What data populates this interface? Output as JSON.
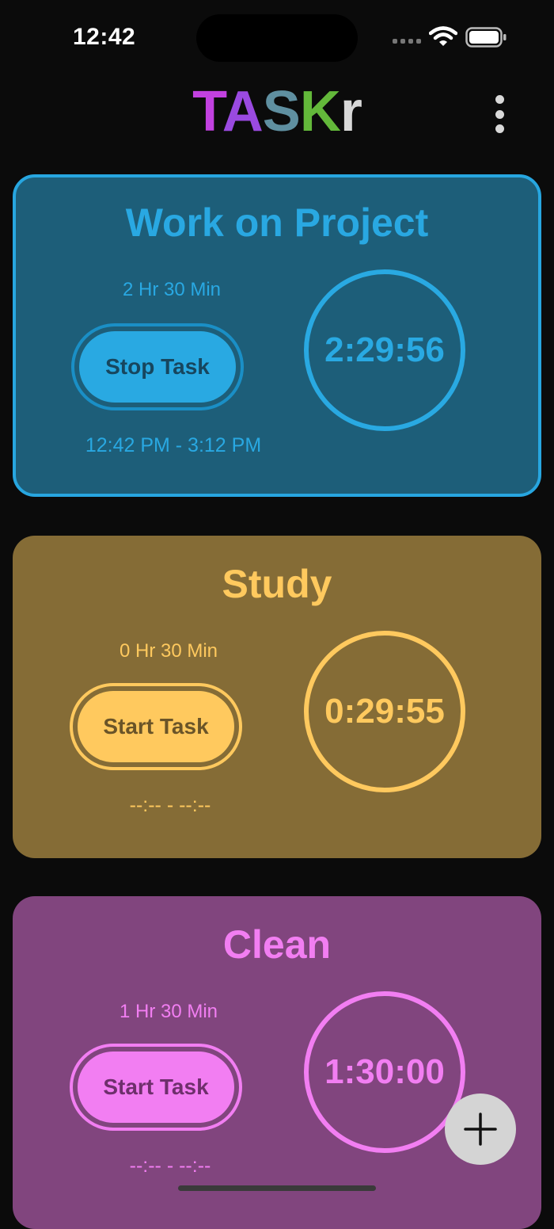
{
  "status_bar": {
    "time": "12:42"
  },
  "header": {
    "title_letters": [
      "T",
      "A",
      "S",
      "K",
      "r"
    ],
    "menu_icon": "more-vertical-icon"
  },
  "tasks": [
    {
      "title": "Work on Project",
      "duration": "2 Hr 30 Min",
      "button_label": "Stop Task",
      "time_range": "12:42 PM - 3:12 PM",
      "timer": "2:29:56",
      "color": "#29a8e2",
      "active": true
    },
    {
      "title": "Study",
      "duration": "0 Hr 30 Min",
      "button_label": "Start Task",
      "time_range": "--:-- - --:--",
      "timer": "0:29:55",
      "color": "#ffc95e",
      "active": false
    },
    {
      "title": "Clean",
      "duration": "1 Hr 30 Min",
      "button_label": "Start Task",
      "time_range": "--:-- - --:--",
      "timer": "1:30:00",
      "color": "#f27ef2",
      "active": false
    }
  ],
  "fab": {
    "icon": "plus-icon"
  }
}
